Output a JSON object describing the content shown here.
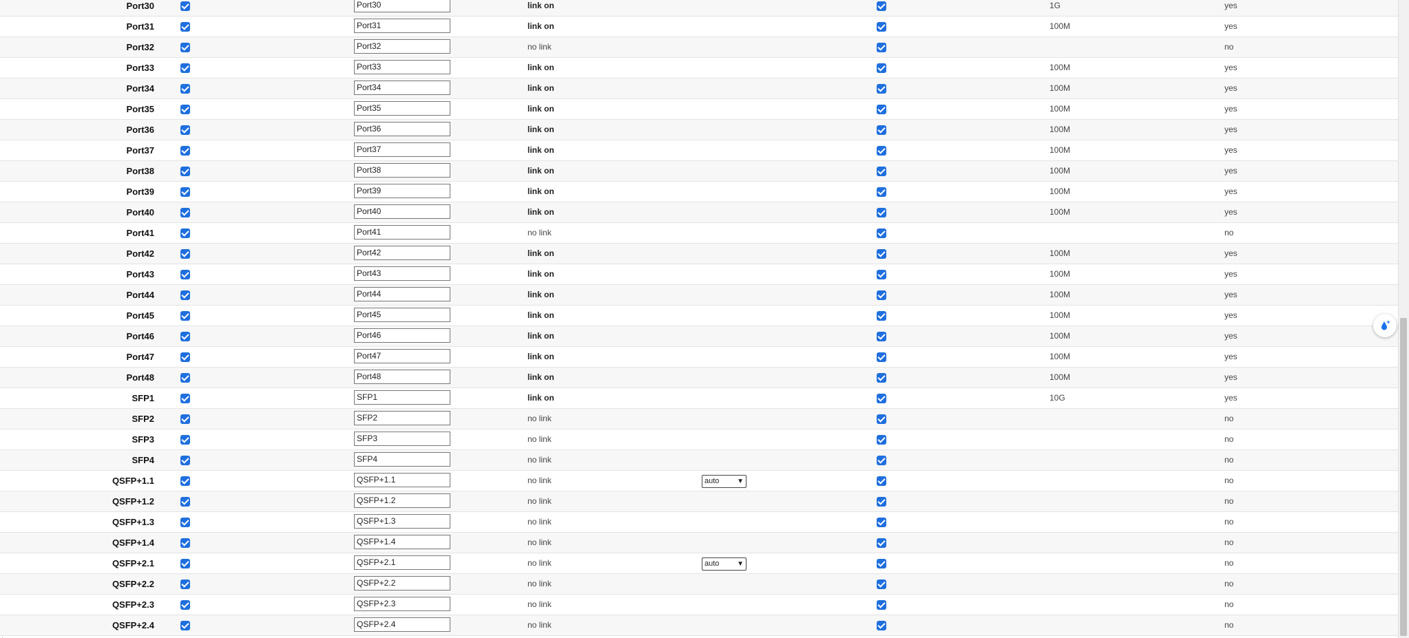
{
  "ports": [
    {
      "name": "Port30",
      "value": "Port30",
      "status": "link on",
      "speed": "1G",
      "up": "yes",
      "select": null
    },
    {
      "name": "Port31",
      "value": "Port31",
      "status": "link on",
      "speed": "100M",
      "up": "yes",
      "select": null
    },
    {
      "name": "Port32",
      "value": "Port32",
      "status": "no link",
      "speed": "",
      "up": "no",
      "select": null
    },
    {
      "name": "Port33",
      "value": "Port33",
      "status": "link on",
      "speed": "100M",
      "up": "yes",
      "select": null
    },
    {
      "name": "Port34",
      "value": "Port34",
      "status": "link on",
      "speed": "100M",
      "up": "yes",
      "select": null
    },
    {
      "name": "Port35",
      "value": "Port35",
      "status": "link on",
      "speed": "100M",
      "up": "yes",
      "select": null
    },
    {
      "name": "Port36",
      "value": "Port36",
      "status": "link on",
      "speed": "100M",
      "up": "yes",
      "select": null
    },
    {
      "name": "Port37",
      "value": "Port37",
      "status": "link on",
      "speed": "100M",
      "up": "yes",
      "select": null
    },
    {
      "name": "Port38",
      "value": "Port38",
      "status": "link on",
      "speed": "100M",
      "up": "yes",
      "select": null
    },
    {
      "name": "Port39",
      "value": "Port39",
      "status": "link on",
      "speed": "100M",
      "up": "yes",
      "select": null
    },
    {
      "name": "Port40",
      "value": "Port40",
      "status": "link on",
      "speed": "100M",
      "up": "yes",
      "select": null
    },
    {
      "name": "Port41",
      "value": "Port41",
      "status": "no link",
      "speed": "",
      "up": "no",
      "select": null
    },
    {
      "name": "Port42",
      "value": "Port42",
      "status": "link on",
      "speed": "100M",
      "up": "yes",
      "select": null
    },
    {
      "name": "Port43",
      "value": "Port43",
      "status": "link on",
      "speed": "100M",
      "up": "yes",
      "select": null
    },
    {
      "name": "Port44",
      "value": "Port44",
      "status": "link on",
      "speed": "100M",
      "up": "yes",
      "select": null
    },
    {
      "name": "Port45",
      "value": "Port45",
      "status": "link on",
      "speed": "100M",
      "up": "yes",
      "select": null
    },
    {
      "name": "Port46",
      "value": "Port46",
      "status": "link on",
      "speed": "100M",
      "up": "yes",
      "select": null
    },
    {
      "name": "Port47",
      "value": "Port47",
      "status": "link on",
      "speed": "100M",
      "up": "yes",
      "select": null
    },
    {
      "name": "Port48",
      "value": "Port48",
      "status": "link on",
      "speed": "100M",
      "up": "yes",
      "select": null
    },
    {
      "name": "SFP1",
      "value": "SFP1",
      "status": "link on",
      "speed": "10G",
      "up": "yes",
      "select": null
    },
    {
      "name": "SFP2",
      "value": "SFP2",
      "status": "no link",
      "speed": "",
      "up": "no",
      "select": null
    },
    {
      "name": "SFP3",
      "value": "SFP3",
      "status": "no link",
      "speed": "",
      "up": "no",
      "select": null
    },
    {
      "name": "SFP4",
      "value": "SFP4",
      "status": "no link",
      "speed": "",
      "up": "no",
      "select": null
    },
    {
      "name": "QSFP+1.1",
      "value": "QSFP+1.1",
      "status": "no link",
      "speed": "",
      "up": "no",
      "select": "auto"
    },
    {
      "name": "QSFP+1.2",
      "value": "QSFP+1.2",
      "status": "no link",
      "speed": "",
      "up": "no",
      "select": null
    },
    {
      "name": "QSFP+1.3",
      "value": "QSFP+1.3",
      "status": "no link",
      "speed": "",
      "up": "no",
      "select": null
    },
    {
      "name": "QSFP+1.4",
      "value": "QSFP+1.4",
      "status": "no link",
      "speed": "",
      "up": "no",
      "select": null
    },
    {
      "name": "QSFP+2.1",
      "value": "QSFP+2.1",
      "status": "no link",
      "speed": "",
      "up": "no",
      "select": "auto"
    },
    {
      "name": "QSFP+2.2",
      "value": "QSFP+2.2",
      "status": "no link",
      "speed": "",
      "up": "no",
      "select": null
    },
    {
      "name": "QSFP+2.3",
      "value": "QSFP+2.3",
      "status": "no link",
      "speed": "",
      "up": "no",
      "select": null
    },
    {
      "name": "QSFP+2.4",
      "value": "QSFP+2.4",
      "status": "no link",
      "speed": "",
      "up": "no",
      "select": null
    }
  ],
  "checkbox": {
    "enabled_checked": true,
    "col5_checked": true,
    "color": "#1f6fde"
  },
  "floating_button": {
    "icon": "water-drop-sparkle-icon"
  }
}
